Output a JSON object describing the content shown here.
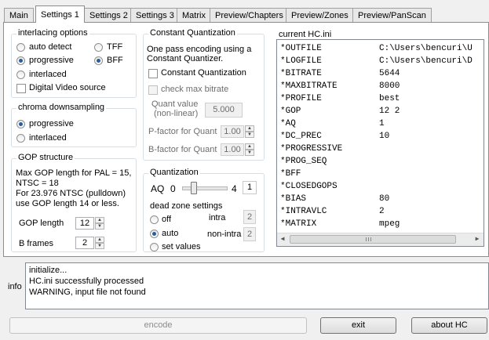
{
  "tabs": [
    {
      "label": "Main",
      "active": false
    },
    {
      "label": "Settings 1",
      "active": true
    },
    {
      "label": "Settings 2",
      "active": false
    },
    {
      "label": "Settings 3",
      "active": false
    },
    {
      "label": "Matrix",
      "active": false
    },
    {
      "label": "Preview/Chapters",
      "active": false
    },
    {
      "label": "Preview/Zones",
      "active": false
    },
    {
      "label": "Preview/PanScan",
      "active": false
    }
  ],
  "interlacing": {
    "title": "interlacing options",
    "auto_detect": "auto detect",
    "progressive": "progressive",
    "interlaced": "interlaced",
    "dvd_source": "Digital Video source",
    "tff": "TFF",
    "bff": "BFF"
  },
  "chroma": {
    "title": "chroma downsampling",
    "progressive": "progressive",
    "interlaced": "interlaced"
  },
  "gop": {
    "title": "GOP structure",
    "info_line1": "Max GOP length for PAL = 15,",
    "info_line2": "NTSC = 18",
    "info_line3": "For 23.976 NTSC (pulldown)",
    "info_line4": "use GOP length 14 or less.",
    "length_label": "GOP length",
    "length_value": "12",
    "bframes_label": "B frames",
    "bframes_value": "2"
  },
  "cq": {
    "title": "Constant Quantization",
    "desc_line1": "One pass encoding using a",
    "desc_line2": "Constant Quantizer.",
    "checkbox_label": "Constant Quantization",
    "max_bitrate_label": "check max bitrate",
    "quant_label_line1": "Quant value",
    "quant_label_line2": "(non-linear)",
    "quant_value": "5.000",
    "pfactor_label": "P-factor for Quant",
    "pfactor_value": "1.00",
    "bfactor_label": "B-factor for Quant",
    "bfactor_value": "1.00"
  },
  "quantization": {
    "title": "Quantization",
    "aq_label": "AQ",
    "aq_min": "0",
    "aq_max": "4",
    "aq_value": "1",
    "aq_level": 0.25,
    "deadzone_title": "dead zone settings",
    "off": "off",
    "auto": "auto",
    "set_values": "set values",
    "intra_label": "intra",
    "intra_value": "2",
    "nonintra_label": "non-intra",
    "nonintra_value": "2"
  },
  "ini": {
    "title": "current HC.ini",
    "rows": [
      {
        "k": "*OUTFILE",
        "v": "C:\\Users\\bencuri\\U"
      },
      {
        "k": "*LOGFILE",
        "v": "C:\\Users\\bencuri\\D"
      },
      {
        "k": "*BITRATE",
        "v": "5644"
      },
      {
        "k": "*MAXBITRATE",
        "v": "8000"
      },
      {
        "k": "*PROFILE",
        "v": "best"
      },
      {
        "k": "*GOP",
        "v": "12 2"
      },
      {
        "k": "*AQ",
        "v": "1"
      },
      {
        "k": "*DC_PREC",
        "v": "10"
      },
      {
        "k": "*PROGRESSIVE",
        "v": ""
      },
      {
        "k": "*PROG_SEQ",
        "v": ""
      },
      {
        "k": "*BFF",
        "v": ""
      },
      {
        "k": "*CLOSEDGOPS",
        "v": ""
      },
      {
        "k": "*BIAS",
        "v": "80"
      },
      {
        "k": "*INTRAVLC",
        "v": "2"
      },
      {
        "k": "*MATRIX",
        "v": "mpeg"
      }
    ]
  },
  "info": {
    "label": "info",
    "lines": [
      "initialize...",
      "HC.ini successfully processed",
      "WARNING, input file not found"
    ]
  },
  "buttons": {
    "encode": "encode",
    "exit": "exit",
    "about": "about HC"
  }
}
